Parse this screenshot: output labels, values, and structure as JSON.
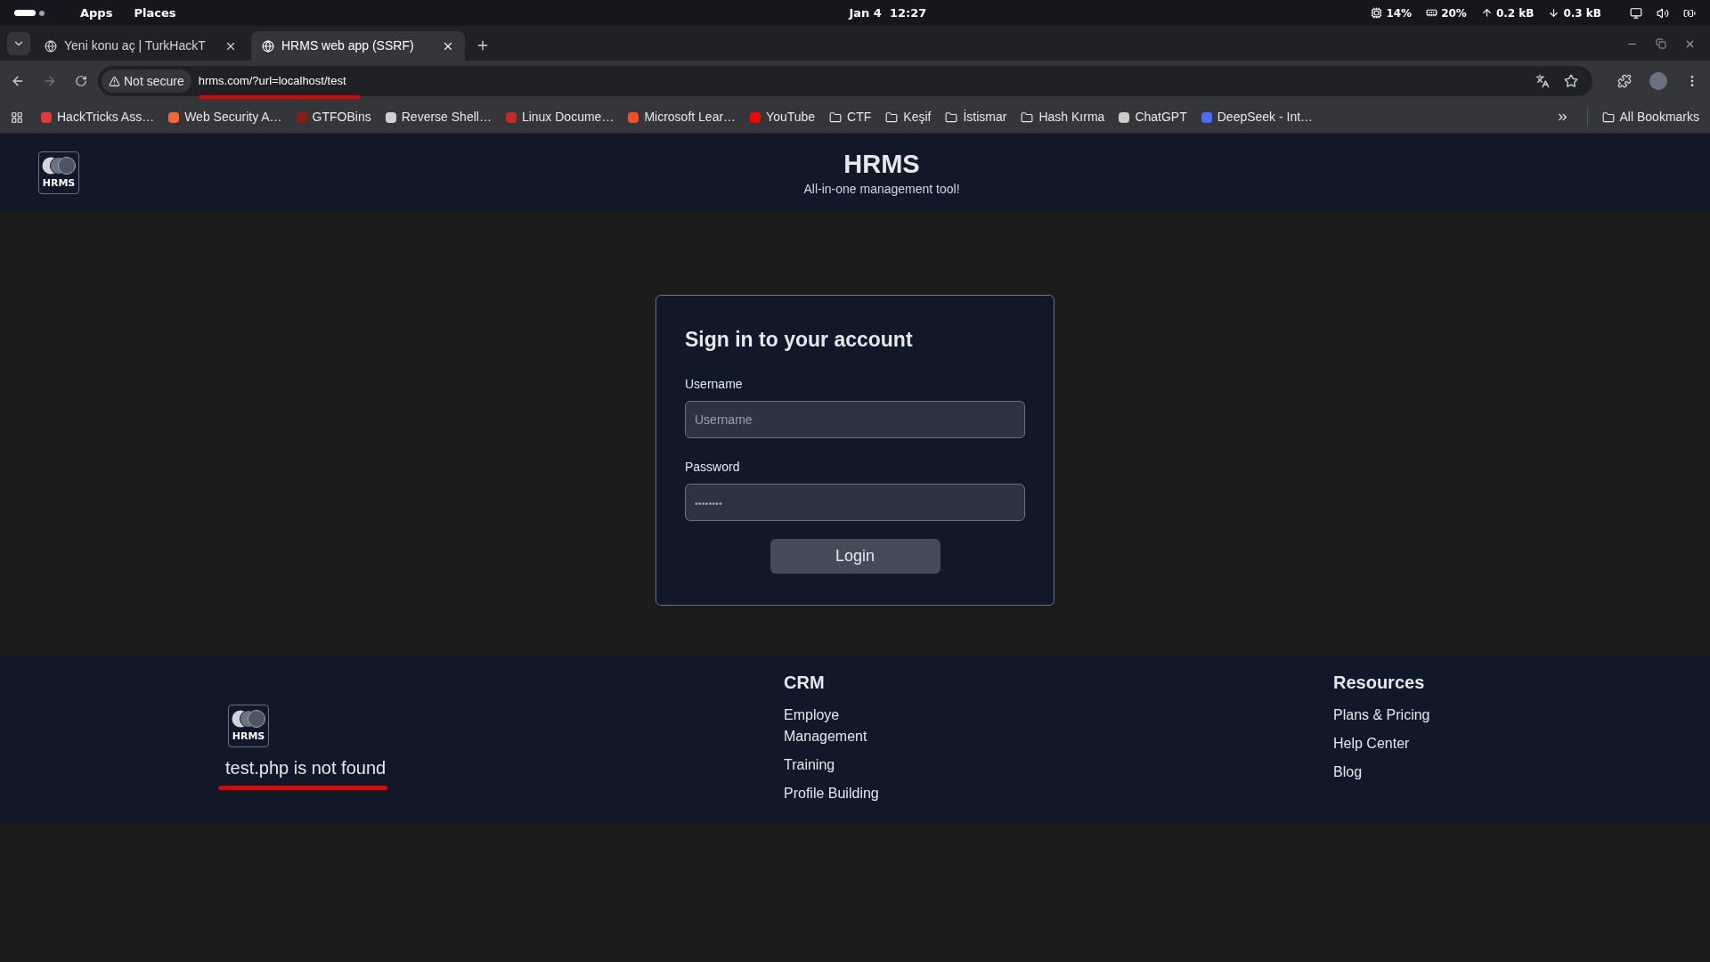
{
  "system_bar": {
    "menus": [
      "Apps",
      "Places"
    ],
    "clock": "Jan 4  12:27",
    "indicators": [
      {
        "kind": "cpu",
        "text": "14%"
      },
      {
        "kind": "memory",
        "text": "20%"
      },
      {
        "kind": "upload",
        "text": "0.2 kB"
      },
      {
        "kind": "download",
        "text": "0.3 kB"
      }
    ]
  },
  "tabs": [
    {
      "title": "Yeni konu aç | TurkHackT",
      "selected": false
    },
    {
      "title": "HRMS web app (SSRF)",
      "selected": true
    }
  ],
  "address_bar": {
    "security": "Not secure",
    "url": "hrms.com/?url=localhost/test"
  },
  "bookmarks": [
    {
      "kind": "site",
      "label": "HackTricks Ass…",
      "color": "#e53935"
    },
    {
      "kind": "site",
      "label": "Web Security A…",
      "color": "#ff6633"
    },
    {
      "kind": "site",
      "label": "GTFOBins",
      "color": "#8b1a1a"
    },
    {
      "kind": "site",
      "label": "Reverse Shell…",
      "color": "#d0d0d0"
    },
    {
      "kind": "site",
      "label": "Linux Docume…",
      "color": "#c62828"
    },
    {
      "kind": "site",
      "label": "Microsoft Lear…",
      "color": "#f25022"
    },
    {
      "kind": "site",
      "label": "YouTube",
      "color": "#ff0000"
    },
    {
      "kind": "folder",
      "label": "CTF"
    },
    {
      "kind": "folder",
      "label": "Keşif"
    },
    {
      "kind": "folder",
      "label": "İstismar"
    },
    {
      "kind": "folder",
      "label": "Hash Kırma"
    },
    {
      "kind": "site",
      "label": "ChatGPT",
      "color": "#cccccc"
    },
    {
      "kind": "site",
      "label": "DeepSeek - Int…",
      "color": "#4d6bfe"
    }
  ],
  "all_bookmarks": "All Bookmarks",
  "header": {
    "logo_text": "HRMS",
    "title": "HRMS",
    "subtitle": "All-in-one management tool!"
  },
  "login": {
    "title": "Sign in to your account",
    "fields": [
      {
        "label": "Username",
        "placeholder": "Username",
        "kind": "text"
      },
      {
        "label": "Password",
        "placeholder": "••••••••",
        "kind": "password"
      }
    ],
    "button": "Login"
  },
  "footer": {
    "logo_text": "HRMS",
    "message": "test.php is not found",
    "columns": [
      {
        "heading": "CRM",
        "links": [
          "Employe Management",
          "Training",
          "Profile Building"
        ]
      },
      {
        "heading": "Resources",
        "links": [
          "Plans & Pricing",
          "Help Center",
          "Blog"
        ]
      }
    ]
  }
}
